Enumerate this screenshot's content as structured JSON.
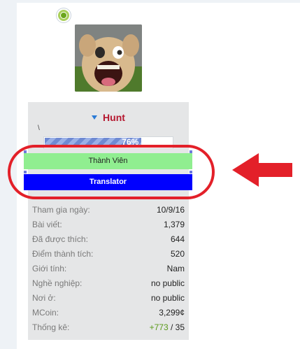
{
  "profile": {
    "username": "Hunt",
    "user_title": "\\",
    "progress_text": "76%",
    "progress_value": 0.76,
    "banners": {
      "member": "Thành Viên",
      "translator": "Translator"
    }
  },
  "stats": [
    {
      "label": "Tham gia ngày:",
      "value": "10/9/16"
    },
    {
      "label": "Bài viết:",
      "value": "1,379"
    },
    {
      "label": "Đã được thích:",
      "value": "644"
    },
    {
      "label": "Điểm thành tích:",
      "value": "520"
    },
    {
      "label": "Giới tính:",
      "value": "Nam"
    },
    {
      "label": "Nghề nghiệp:",
      "value": "no public"
    },
    {
      "label": "Nơi ở:",
      "value": "no public"
    },
    {
      "label": "MCoin:",
      "value": "3,299¢"
    },
    {
      "label": "Thống kê:",
      "positive": "+773",
      "separator": " / ",
      "negative": "35"
    }
  ],
  "colors": {
    "username": "#b5172f",
    "member_banner": "#90ee90",
    "translator_banner": "#0000ff",
    "highlight": "#e32029",
    "online": "#6aa51c"
  },
  "icons": {
    "online_status": "online-status-icon",
    "caret": "caret-down-icon",
    "annotation": "red-arrow-icon"
  }
}
